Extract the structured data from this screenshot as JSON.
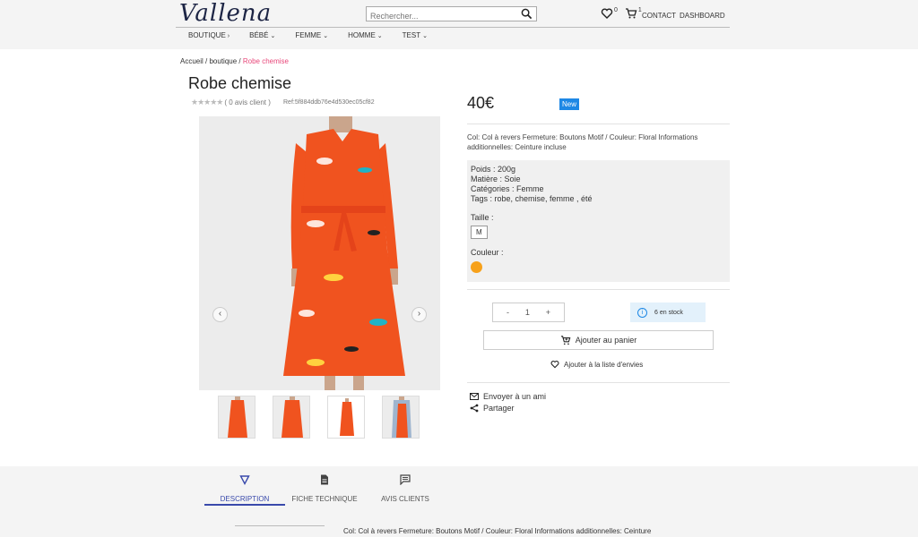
{
  "header": {
    "logo": "Vallena",
    "search_placeholder": "Rechercher...",
    "wishlist_count": "0",
    "cart_count": "1",
    "contact": "CONTACT",
    "dashboard": "DASHBOARD"
  },
  "nav": [
    {
      "label": "BOUTIQUE",
      "chev": "›"
    },
    {
      "label": "BÉBÉ",
      "chev": "⌄"
    },
    {
      "label": "FEMME",
      "chev": "⌄"
    },
    {
      "label": "HOMME",
      "chev": "⌄"
    },
    {
      "label": "TEST",
      "chev": "⌄"
    }
  ],
  "breadcrumb": {
    "home": "Accueil",
    "sep1": " / ",
    "shop": "boutique",
    "sep2": " / ",
    "current": "Robe chemise"
  },
  "product": {
    "title": "Robe chemise",
    "stars": "★★★★★",
    "reviews": "( 0 avis client )",
    "ref": "Ref:5f884ddb76e4d530ec05cf82",
    "price": "40€",
    "badge": "New",
    "description": "Col: Col à revers Fermeture: Boutons Motif / Couleur: Floral Informations additionnelles: Ceinture incluse",
    "poids": "Poids : 200g",
    "matiere": "Matière : Soie",
    "categories": "Catégories : Femme",
    "tags": "Tags : robe, chemise, femme , été",
    "taille_label": "Taille :",
    "taille_value": "M",
    "couleur_label": "Couleur :",
    "couleur_hex": "#f7a11a",
    "qty_minus": "-",
    "qty_value": "1",
    "qty_plus": "+",
    "stock": "6 en stock",
    "add_to_cart": "Ajouter au panier",
    "add_to_wishlist": "Ajouter à la liste d'envies",
    "send_friend": "Envoyer à un ami",
    "share": "Partager"
  },
  "tabs": [
    {
      "label": "DESCRIPTION",
      "icon": "triangle-down-icon",
      "active": true
    },
    {
      "label": "FICHE TECHNIQUE",
      "icon": "document-icon",
      "active": false
    },
    {
      "label": "AVIS CLIENTS",
      "icon": "comment-icon",
      "active": false
    }
  ],
  "tab_content": "Col: Col à revers Fermeture: Boutons Motif / Couleur: Floral Informations additionnelles: Ceinture",
  "colors": {
    "accent": "#3949ab",
    "badge": "#1e88e5",
    "breadcrumb_current": "#e8477a",
    "dress": "#f0531f"
  }
}
